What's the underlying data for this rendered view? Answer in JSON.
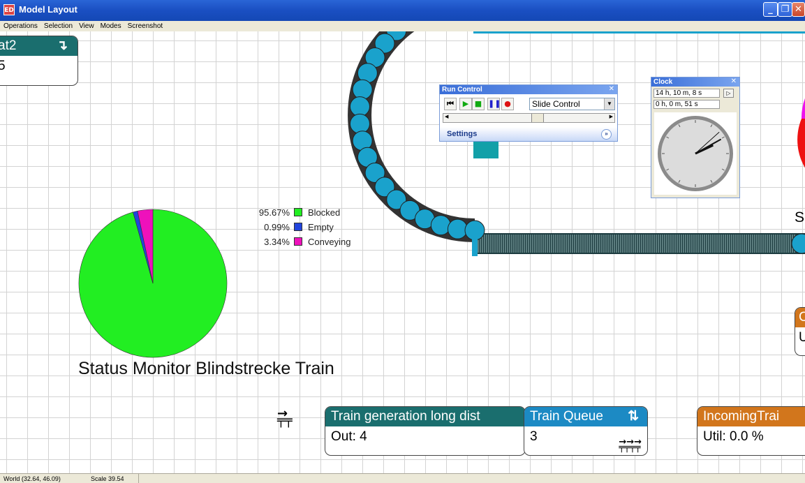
{
  "window": {
    "title": "Model Layout",
    "app_icon": "ED"
  },
  "menu": [
    "Operations",
    "Selection",
    "View",
    "Modes",
    "Screenshot"
  ],
  "status": {
    "world": "World (32.64, 46.09)",
    "scale": "Scale 39.54"
  },
  "status_monitor": {
    "title": "Status Monitor Blindstrecke Train",
    "chart_data": {
      "type": "pie",
      "categories": [
        "Blocked",
        "Empty",
        "Conveying"
      ],
      "values": [
        95.67,
        0.99,
        3.34
      ],
      "labels": [
        "95.67%",
        "0.99%",
        "3.34%"
      ],
      "colors": [
        "#22ee22",
        "#2244dd",
        "#ee11bb"
      ]
    }
  },
  "nodes": {
    "top_left": {
      "title": "at2",
      "value": "5"
    },
    "train_generation": {
      "title": "Train generation long dist",
      "value": "Out: 4"
    },
    "train_queue": {
      "title": "Train Queue",
      "value": "3"
    },
    "incoming": {
      "title": "IncomingTrai",
      "value": "Util: 0.0 %"
    },
    "right_edge": {
      "title": "C",
      "value": "U"
    }
  },
  "right_edge_text": "S",
  "run_control": {
    "title": "Run Control",
    "combo": "Slide Control",
    "settings": "Settings",
    "slider_fraction": 0.55
  },
  "clock": {
    "title": "Clock",
    "sim_time": "14 h, 10 m, 8 s",
    "real_time": "0 h, 0 m, 51 s"
  },
  "colors": {
    "teal": "#1a6e6e",
    "blue": "#1c8ac4",
    "orange": "#d2761c",
    "conveyor": "#1aa2cc"
  }
}
